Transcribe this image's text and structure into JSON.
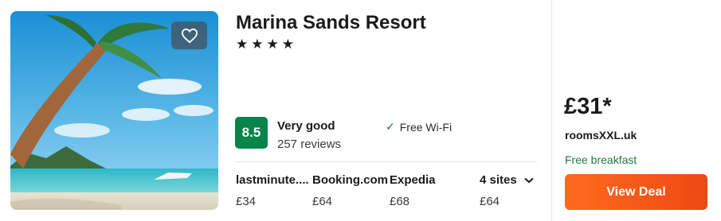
{
  "hotel": {
    "name": "Marina Sands Resort",
    "stars_text": "★★★★",
    "rating_score": "8.5",
    "rating_label": "Very good",
    "reviews": "257 reviews",
    "amenity": "Free Wi-Fi",
    "image_icon": "beach-palm-photo",
    "favorite_icon": "heart-icon"
  },
  "offers": [
    {
      "site": "lastminute....",
      "price": "£34"
    },
    {
      "site": "Booking.com",
      "price": "£64"
    },
    {
      "site": "Expedia",
      "price": "£68"
    }
  ],
  "more_sites": {
    "label": "4 sites",
    "price": "£64",
    "icon": "chevron-down-icon"
  },
  "deal": {
    "price": "£31*",
    "provider": "roomsXXL.uk",
    "perk": "Free breakfast",
    "button_label": "View Deal"
  },
  "colors": {
    "rating_badge": "#07844a",
    "deal_button": "#f05a16",
    "perk_text": "#1f7a3f"
  }
}
